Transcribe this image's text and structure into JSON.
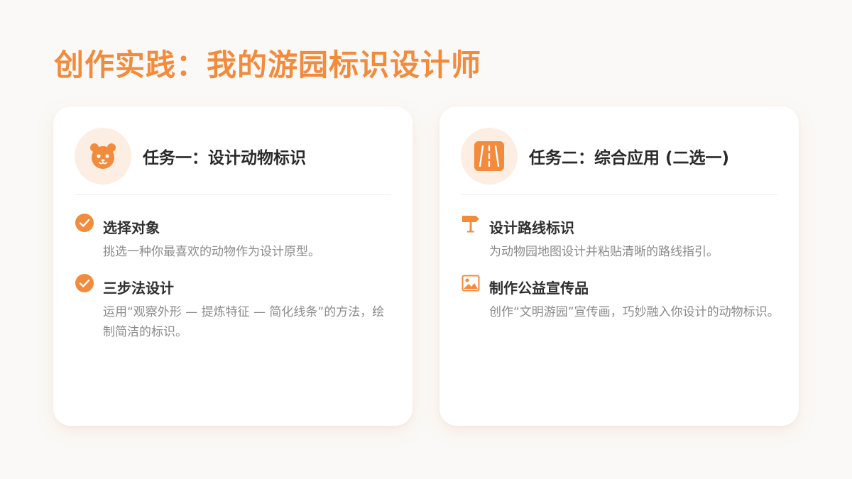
{
  "page": {
    "title": "创作实践：我的游园标识设计师"
  },
  "colors": {
    "accent": "#f38b3c",
    "accent_soft": "#fdeee3",
    "text_dark": "#2f2f2f",
    "text_muted": "#8a8a8a",
    "background": "#faf9f7"
  },
  "cards": [
    {
      "icon": "panda-face-icon",
      "title": "任务一：设计动物标识",
      "items": [
        {
          "icon": "check-circle-icon",
          "title": "选择对象",
          "desc": "挑选一种你最喜欢的动物作为设计原型。"
        },
        {
          "icon": "check-circle-icon",
          "title": "三步法设计",
          "desc": "运用“观察外形 — 提炼特征 — 简化线条”的方法，绘制简洁的标识。"
        }
      ]
    },
    {
      "icon": "road-icon",
      "title": "任务二：综合应用 (二选一)",
      "items": [
        {
          "icon": "signpost-icon",
          "title": "设计路线标识",
          "desc": "为动物园地图设计并粘贴清晰的路线指引。"
        },
        {
          "icon": "image-icon",
          "title": "制作公益宣传品",
          "desc": "创作“文明游园”宣传画，巧妙融入你设计的动物标识。"
        }
      ]
    }
  ]
}
